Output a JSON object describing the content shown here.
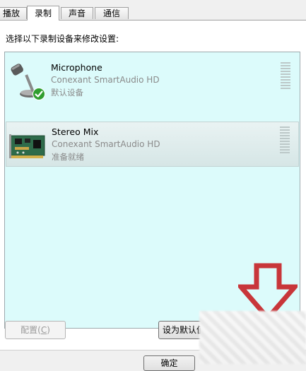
{
  "tabs": [
    {
      "label": "播放"
    },
    {
      "label": "录制"
    },
    {
      "label": "声音"
    },
    {
      "label": "通信"
    }
  ],
  "instruction": "选择以下录制设备来修改设置:",
  "devices": [
    {
      "name": "Microphone",
      "driver": "Conexant SmartAudio HD",
      "status": "默认设备",
      "icon": "microphone-icon",
      "default": true
    },
    {
      "name": "Stereo Mix",
      "driver": "Conexant SmartAudio HD",
      "status": "准备就绪",
      "icon": "sound-card-icon",
      "selected": true
    }
  ],
  "buttons": {
    "configure_label": "配置",
    "configure_key": "C",
    "set_default_label": "设为默认值",
    "ok_label": "确定"
  },
  "colors": {
    "list_background": "#dcfbfb",
    "arrow": "#c8363a",
    "check": "#2f9e2f"
  }
}
